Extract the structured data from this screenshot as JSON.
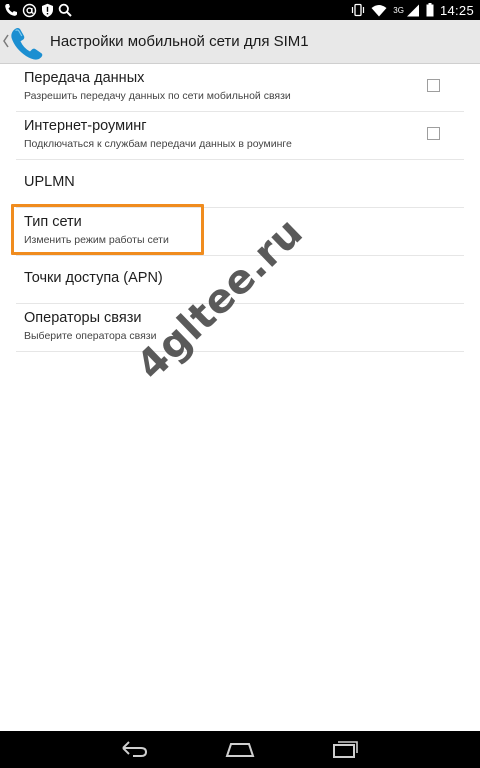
{
  "status_bar": {
    "time": "14:25",
    "network_type": "3G",
    "left_icons": [
      "phone-handset-icon",
      "at-sign-icon",
      "warning-shield-icon",
      "search-icon"
    ],
    "right_icons": [
      "vibrate-icon",
      "wifi-icon",
      "signal-icon",
      "battery-icon"
    ]
  },
  "action_bar": {
    "title": "Настройки мобильной сети для SIM1",
    "app_icon": "phone-handset-icon"
  },
  "settings": {
    "items": [
      {
        "title": "Передача данных",
        "summary": "Разрешить передачу данных по сети мобильной связи",
        "checked": false
      },
      {
        "title": "Интернет-роуминг",
        "summary": "Подключаться к службам передачи данных в роуминге",
        "checked": false
      },
      {
        "title": "UPLMN"
      },
      {
        "title": "Тип сети",
        "summary": "Изменить режим работы сети",
        "highlighted": true
      },
      {
        "title": "Точки доступа (APN)"
      },
      {
        "title": "Операторы связи",
        "summary": "Выберите оператора связи"
      }
    ]
  },
  "watermark": "4glteе.ru",
  "nav_bar": {
    "buttons": [
      "back-icon",
      "home-icon",
      "recents-icon"
    ]
  },
  "colors": {
    "highlight": "#f08c1e",
    "status_bar_bg": "#000000",
    "action_bar_bg": "#e8e8e8"
  }
}
